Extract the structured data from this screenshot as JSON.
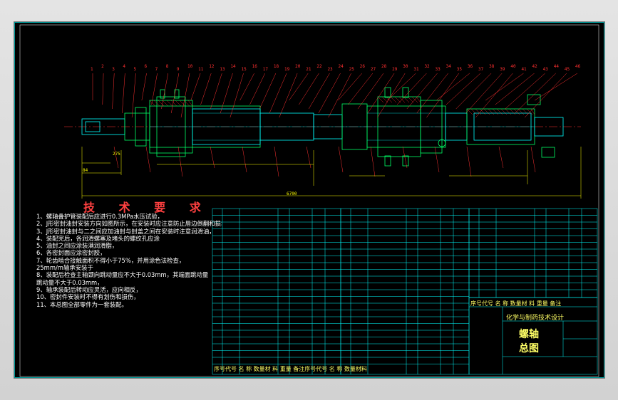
{
  "drawing": {
    "tech_title": "技 术 要 求",
    "tech_notes": [
      "1、螺轴叠护管装配后应进行0.3MPa水压试验，",
      "2、J形密封油封安装方向如图所示，在安装时应注意防止唇边倒翻和损坏，",
      "3、J形密封油封与二之间应加油封与封盖之间在安装时注意润滑油，",
      "4、装配完后，各润滑螺塞及堵头的螺纹孔应涂",
      "5、油封之间应涂装满润滑脂，",
      "6、各密封面应涂密封胶，",
      "7、轮齿啮合接触面积不得小于75%，并用涂色法检查，",
      "   25mm/m轴承安装于",
      "8、装配后检查主轴颈向跳动量应不大于0.03mm，其端面跳动量",
      "   跳动量不大于0.03mm，",
      "9、轴承装配后转动应灵活，应向相反，",
      "10、密封件安装时不得有划伤和损伤，",
      "11、本总图全部零件为一套装配。"
    ],
    "overall_dim": "6700",
    "dim_275": "275",
    "dim_84": "84",
    "part_numbers_top": [
      "1",
      "2",
      "3",
      "4",
      "5",
      "6",
      "7",
      "8",
      "9",
      "10",
      "11",
      "12",
      "13",
      "14",
      "15",
      "16",
      "17",
      "18",
      "19",
      "20",
      "21",
      "22",
      "23",
      "24",
      "25",
      "26",
      "27",
      "28",
      "29",
      "30",
      "31",
      "32",
      "33",
      "34",
      "35",
      "36",
      "37",
      "38",
      "39",
      "40",
      "41",
      "42",
      "43",
      "44",
      "45",
      "46"
    ],
    "title_block": {
      "company": "化学与制药技术设计",
      "drawing_name": "螺轴",
      "drawing_type": "总图",
      "header_row": "序号代号  名 称 数量材 料 重量 备注",
      "footer_row": "序号代号   名   称  数量材 料 重量 备注序号代号   名   称  数量材料"
    }
  },
  "colors": {
    "background": "#000000",
    "outline": "#00ff66",
    "shaft": "#00ffff",
    "dimension": "#ffff00",
    "leader": "#ff3030",
    "table": "#00ffff",
    "text": "#ffffff"
  }
}
